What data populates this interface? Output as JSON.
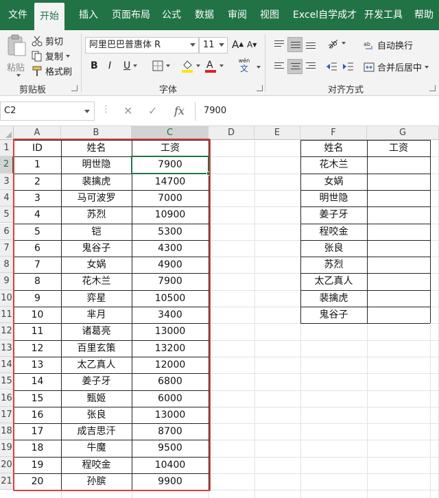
{
  "ribbon_tabs": [
    "文件",
    "开始",
    "插入",
    "页面布局",
    "公式",
    "数据",
    "审阅",
    "视图",
    "Excel自学成才",
    "开发工具",
    "帮助"
  ],
  "active_tab": "开始",
  "clipboard": {
    "paste": "粘贴",
    "cut": "剪切",
    "copy": "复制",
    "format_painter": "格式刷",
    "label": "剪贴板"
  },
  "font": {
    "name": "阿里巴巴普惠体 R",
    "size": "11",
    "bold": "B",
    "italic": "I",
    "underline": "U",
    "grow": "A",
    "shrink": "A",
    "phonetic_top": "wén",
    "phonetic_bottom": "文",
    "label": "字体"
  },
  "alignment": {
    "wrap_text": "自动换行",
    "merge_center": "合并后居中",
    "label": "对齐方式"
  },
  "formula_bar": {
    "name_box": "C2",
    "fx": "fx",
    "value": "7900"
  },
  "columns": [
    "A",
    "B",
    "C",
    "D",
    "E",
    "F",
    "G"
  ],
  "rows": [
    "1",
    "2",
    "3",
    "4",
    "5",
    "6",
    "7",
    "8",
    "9",
    "10",
    "11",
    "12",
    "13",
    "14",
    "15",
    "16",
    "17",
    "18",
    "19",
    "20",
    "21"
  ],
  "selected_cell": "C2",
  "left_table": {
    "headers": [
      "ID",
      "姓名",
      "工资"
    ],
    "rows": [
      [
        "1",
        "明世隐",
        "7900"
      ],
      [
        "2",
        "裴擒虎",
        "14700"
      ],
      [
        "3",
        "马可波罗",
        "7000"
      ],
      [
        "4",
        "苏烈",
        "10900"
      ],
      [
        "5",
        "铠",
        "5300"
      ],
      [
        "6",
        "鬼谷子",
        "4300"
      ],
      [
        "7",
        "女娲",
        "4900"
      ],
      [
        "8",
        "花木兰",
        "7900"
      ],
      [
        "9",
        "弈星",
        "10500"
      ],
      [
        "10",
        "芈月",
        "3400"
      ],
      [
        "11",
        "诸葛亮",
        "13000"
      ],
      [
        "12",
        "百里玄策",
        "13200"
      ],
      [
        "13",
        "太乙真人",
        "12000"
      ],
      [
        "14",
        "姜子牙",
        "6800"
      ],
      [
        "15",
        "甄姬",
        "6000"
      ],
      [
        "16",
        "张良",
        "13000"
      ],
      [
        "17",
        "成吉思汗",
        "8700"
      ],
      [
        "18",
        "牛魔",
        "9500"
      ],
      [
        "19",
        "程咬金",
        "10400"
      ],
      [
        "20",
        "孙膑",
        "9900"
      ]
    ]
  },
  "right_table": {
    "headers": [
      "姓名",
      "工资"
    ],
    "names": [
      "花木兰",
      "女娲",
      "明世隐",
      "姜子牙",
      "程咬金",
      "张良",
      "苏烈",
      "太乙真人",
      "裴擒虎",
      "鬼谷子"
    ]
  },
  "colors": {
    "accent": "#217346",
    "highlight_frame": "#e03c3c",
    "font_color_bar": "#e02020",
    "fill_color_bar": "#ffe600"
  }
}
